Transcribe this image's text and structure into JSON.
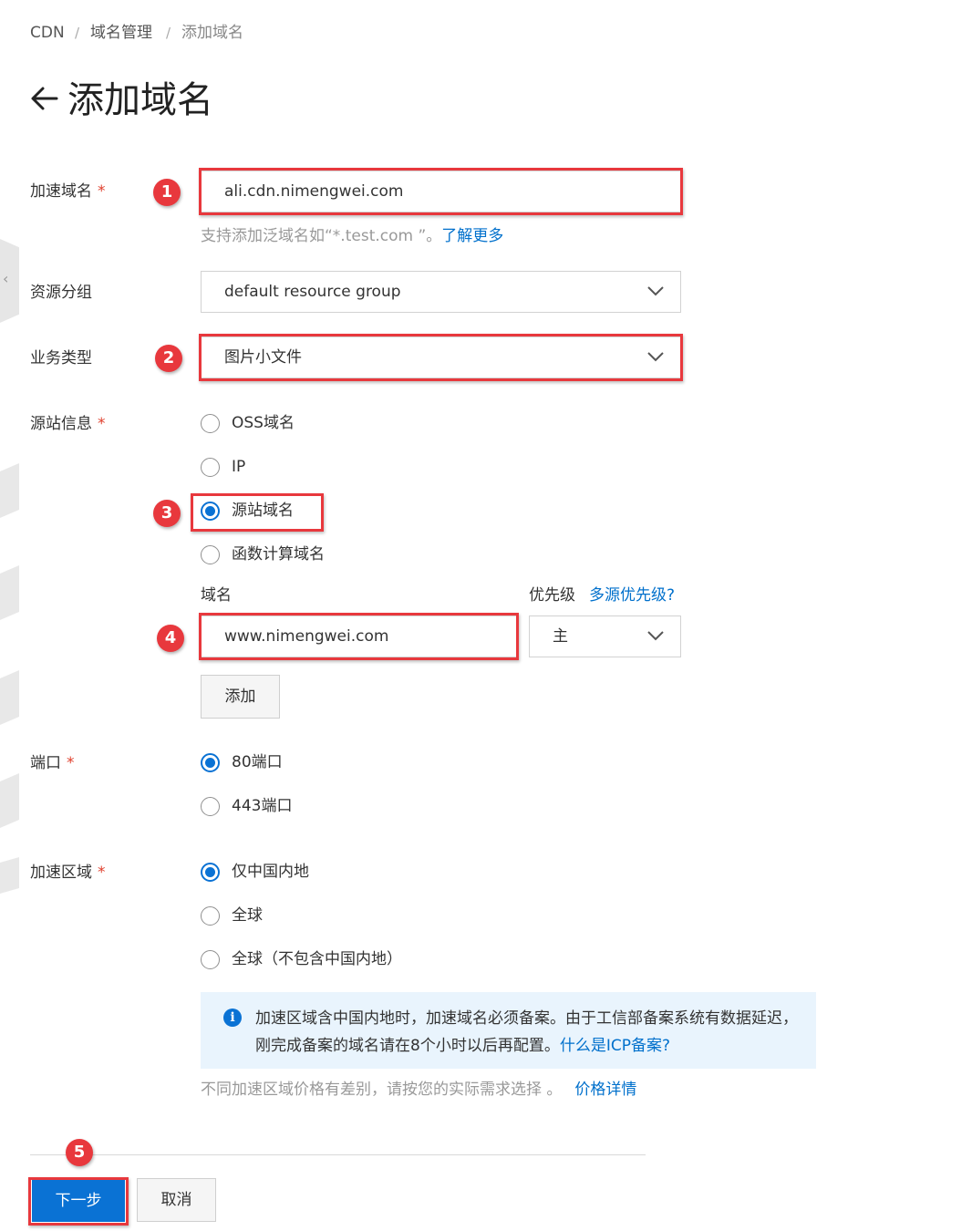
{
  "breadcrumb": {
    "items": [
      "CDN",
      "域名管理",
      "添加域名"
    ],
    "separator": "/"
  },
  "page": {
    "title": "添加域名"
  },
  "form": {
    "domain": {
      "label": "加速域名",
      "required_mark": "*",
      "value": "ali.cdn.nimengwei.com",
      "hint": "支持添加泛域名如“*.test.com ”。",
      "hint_link": "了解更多"
    },
    "resource_group": {
      "label": "资源分组",
      "value": "default resource group"
    },
    "business_type": {
      "label": "业务类型",
      "value": "图片小文件"
    },
    "origin": {
      "label": "源站信息",
      "required_mark": "*",
      "options": [
        "OSS域名",
        "IP",
        "源站域名",
        "函数计算域名"
      ],
      "selected": "源站域名",
      "domain_label": "域名",
      "priority_label": "优先级",
      "priority_link": "多源优先级?",
      "domain_value": "www.nimengwei.com",
      "priority_value": "主",
      "add_button": "添加"
    },
    "port": {
      "label": "端口",
      "required_mark": "*",
      "options": [
        "80端口",
        "443端口"
      ],
      "selected": "80端口"
    },
    "region": {
      "label": "加速区域",
      "required_mark": "*",
      "options": [
        "仅中国内地",
        "全球",
        "全球（不包含中国内地）"
      ],
      "selected": "仅中国内地",
      "info_icon": "i",
      "info_text": "加速区域含中国内地时，加速域名必须备案。由于工信部备案系统有数据延迟，刚完成备案的域名请在8个小时以后再配置。",
      "info_link": "什么是ICP备案?",
      "price_hint": "不同加速区域价格有差别，请按您的实际需求选择 。",
      "price_link": "价格详情"
    }
  },
  "footer": {
    "next_button": "下一步",
    "cancel_button": "取消"
  },
  "annotations": [
    "1",
    "2",
    "3",
    "4",
    "5"
  ],
  "colors": {
    "accent": "#0a72d4",
    "annotation_red": "#e8383d",
    "info_bg": "#e9f4fd",
    "required": "#e0402e"
  }
}
